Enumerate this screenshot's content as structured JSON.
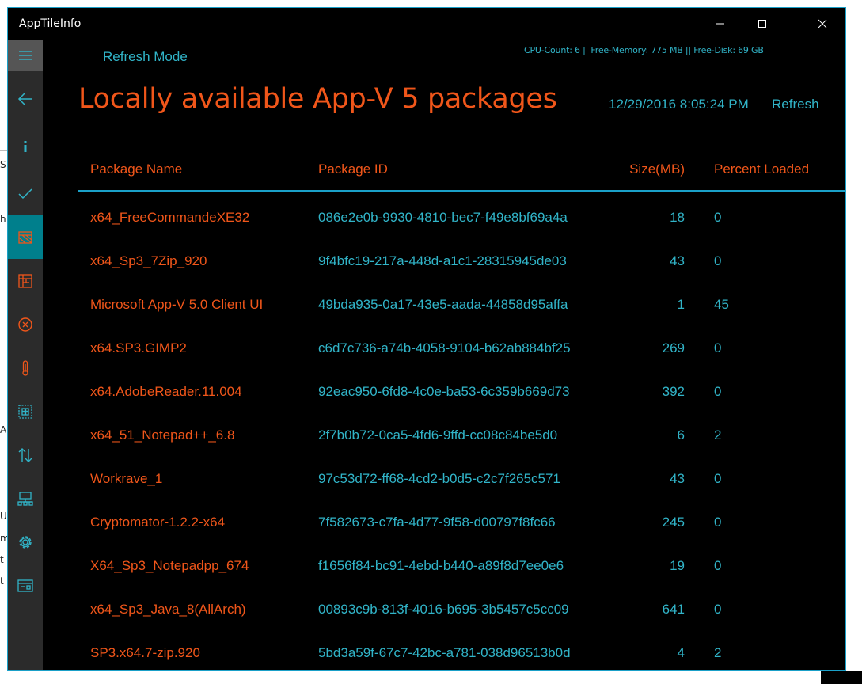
{
  "window": {
    "title": "AppTileInfo"
  },
  "desktop_fragments": [
    "S",
    "h",
    "A",
    "U",
    "m",
    "t",
    "t"
  ],
  "header": {
    "refresh_mode_label": "Refresh Mode",
    "stats": "CPU-Count: 6 || Free-Memory: 775 MB || Free-Disk: 69 GB",
    "page_title": "Locally available App-V 5 packages",
    "timestamp": "12/29/2016 8:05:24 PM",
    "refresh_label": "Refresh"
  },
  "colors": {
    "accent_orange": "#f0561a",
    "accent_teal": "#31b4c8",
    "rail_selected": "#007f8c",
    "background": "#000000"
  },
  "nav": {
    "items": [
      {
        "icon": "hamburger-icon"
      },
      {
        "icon": "back-arrow-icon"
      },
      {
        "icon": "info-icon"
      },
      {
        "icon": "checkmark-icon"
      },
      {
        "icon": "packages-icon",
        "selected": true
      },
      {
        "icon": "package-grid-icon"
      },
      {
        "icon": "cancel-circle-icon"
      },
      {
        "icon": "thermometer-icon"
      },
      {
        "icon": "tiles-icon"
      },
      {
        "icon": "sort-arrows-icon"
      },
      {
        "icon": "network-icon"
      },
      {
        "icon": "gear-icon"
      },
      {
        "icon": "card-icon"
      }
    ]
  },
  "table": {
    "columns": {
      "name": "Package Name",
      "id": "Package ID",
      "size": "Size(MB)",
      "percent": "Percent Loaded"
    },
    "rows": [
      {
        "name": "x64_FreeCommandeXE32",
        "id": "086e2e0b-9930-4810-bec7-f49e8bf69a4a",
        "size": "18",
        "percent": "0"
      },
      {
        "name": "x64_Sp3_7Zip_920",
        "id": "9f4bfc19-217a-448d-a1c1-28315945de03",
        "size": "43",
        "percent": "0"
      },
      {
        "name": "Microsoft App-V 5.0 Client UI",
        "id": "49bda935-0a17-43e5-aada-44858d95affa",
        "size": "1",
        "percent": "45"
      },
      {
        "name": "x64.SP3.GIMP2",
        "id": "c6d7c736-a74b-4058-9104-b62ab884bf25",
        "size": "269",
        "percent": "0"
      },
      {
        "name": "x64.AdobeReader.11.004",
        "id": "92eac950-6fd8-4c0e-ba53-6c359b669d73",
        "size": "392",
        "percent": "0"
      },
      {
        "name": "x64_51_Notepad++_6.8",
        "id": "2f7b0b72-0ca5-4fd6-9ffd-cc08c84be5d0",
        "size": "6",
        "percent": "2"
      },
      {
        "name": "Workrave_1",
        "id": "97c53d72-ff68-4cd2-b0d5-c2c7f265c571",
        "size": "43",
        "percent": "0"
      },
      {
        "name": "Cryptomator-1.2.2-x64",
        "id": "7f582673-c7fa-4d77-9f58-d00797f8fc66",
        "size": "245",
        "percent": "0"
      },
      {
        "name": "X64_Sp3_Notepadpp_674",
        "id": "f1656f84-bc91-4ebd-b440-a89f8d7ee0e6",
        "size": "19",
        "percent": "0"
      },
      {
        "name": "x64_Sp3_Java_8(AllArch)",
        "id": "00893c9b-813f-4016-b695-3b5457c5cc09",
        "size": "641",
        "percent": "0"
      },
      {
        "name": "SP3.x64.7-zip.920",
        "id": "5bd3a59f-67c7-42bc-a781-038d96513b0d",
        "size": "4",
        "percent": "2"
      }
    ]
  }
}
